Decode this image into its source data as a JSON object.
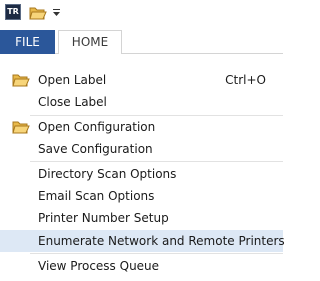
{
  "app": {
    "logo_text": "TR"
  },
  "ribbon": {
    "tabs": [
      {
        "label": "FILE",
        "active": true
      },
      {
        "label": "HOME",
        "active": false
      }
    ],
    "accent_color": "#2b579a"
  },
  "menu": {
    "items": [
      {
        "label": "Open Label",
        "shortcut": "Ctrl+O",
        "icon": "folder-open-icon"
      },
      {
        "label": "Close Label"
      },
      {
        "label": "Open Configuration",
        "icon": "folder-open-icon"
      },
      {
        "label": "Save Configuration"
      },
      {
        "label": "Directory Scan Options"
      },
      {
        "label": "Email Scan Options"
      },
      {
        "label": "Printer Number Setup"
      },
      {
        "label": "Enumerate Network and Remote Printers",
        "highlighted": true
      },
      {
        "label": "View Process Queue"
      }
    ],
    "highlight_color": "#dde8f5"
  }
}
